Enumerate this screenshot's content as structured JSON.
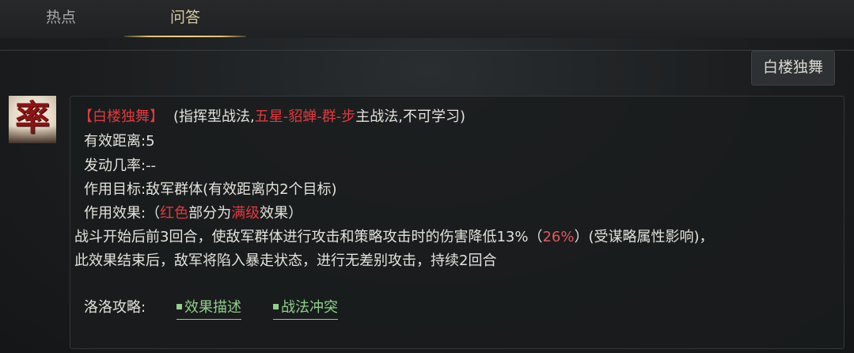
{
  "tabs": [
    {
      "label": "热点",
      "active": false
    },
    {
      "label": "问答",
      "active": true
    }
  ],
  "question": {
    "text": "白楼独舞"
  },
  "avatar": {
    "glyph": "率"
  },
  "answer": {
    "title_bracket": "【白楼独舞】",
    "title_paren_open": "(指挥型战法,",
    "title_highlight": "五星-貂蝉-群-步",
    "title_paren_close": "主战法,不可学习)",
    "range": "有效距离:5",
    "trigger": "发动几率:--",
    "target": "作用目标:敌军群体(有效距离内2个目标)",
    "effect_prefix": "作用效果:（",
    "effect_red1": "红色",
    "effect_mid": "部分为",
    "effect_red2": "满级",
    "effect_suffix": "效果）",
    "desc1_a": "战斗开始后前3回合，使敌军群体进行攻击和策略攻击时的伤害降低13%（",
    "desc1_pct": "26%",
    "desc1_b": "）(受谋略属性影响)，",
    "desc2": "此效果结束后，敌军将陷入暴走状态，进行无差别攻击，持续2回合",
    "guide_label": "洛洛攻略:",
    "links": [
      "效果描述",
      "战法冲突"
    ]
  },
  "colors": {
    "highlight_red": "#e0393c",
    "link_green": "#8fd08a",
    "tab_active": "#d8c89c"
  }
}
